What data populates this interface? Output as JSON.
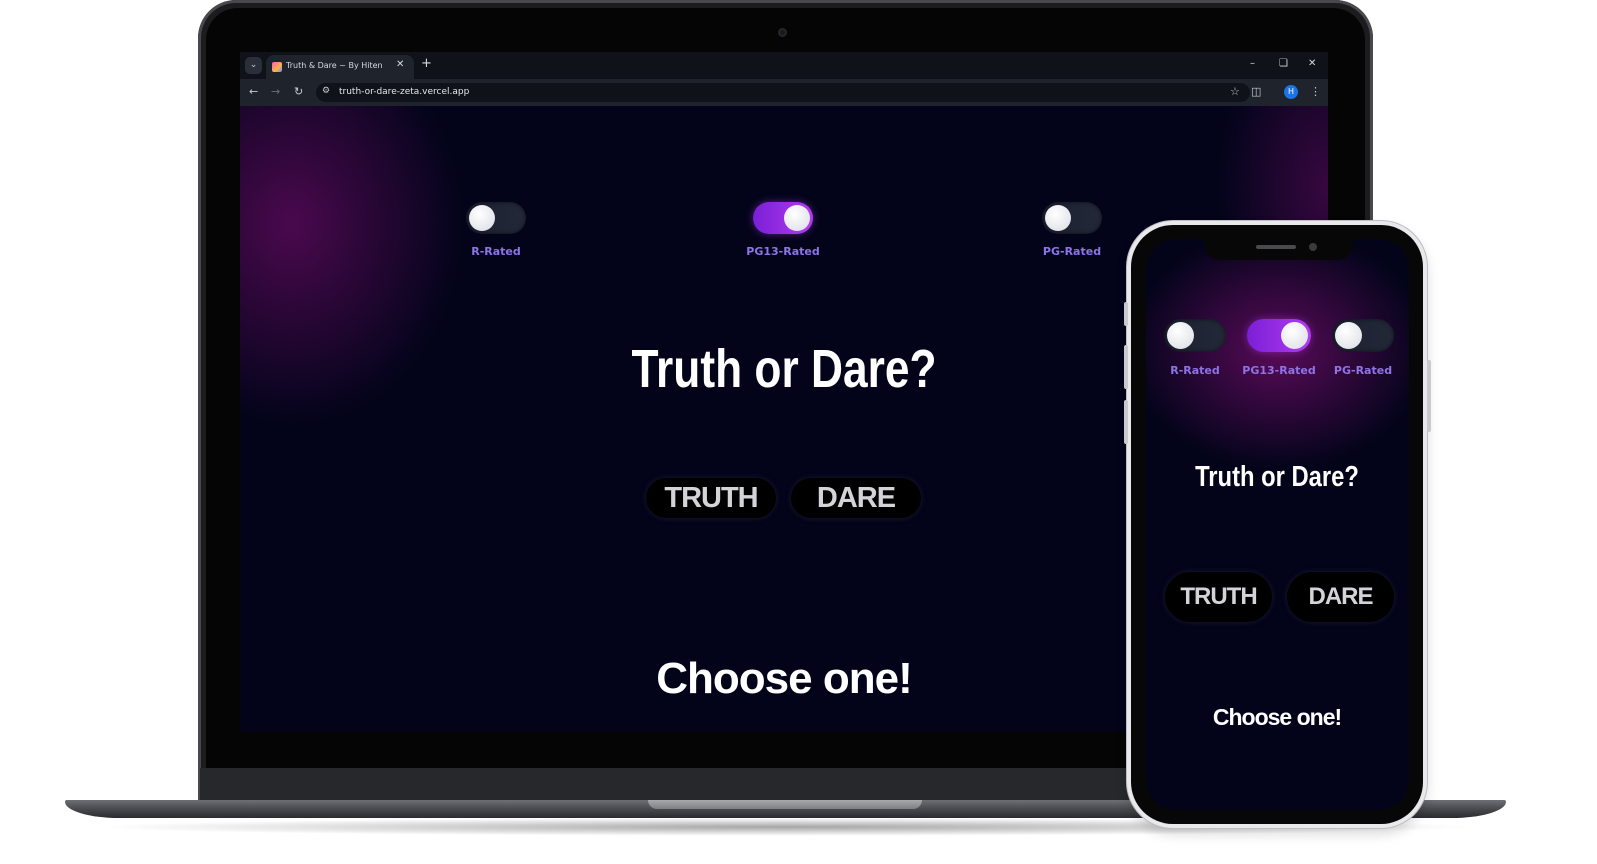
{
  "browser": {
    "tab_title": "Truth & Dare ~ By Hiten",
    "url": "truth-or-dare-zeta.vercel.app",
    "profile_initial": "H",
    "icons": [
      "tab-dropdown-icon",
      "favicon",
      "close-icon",
      "new-tab-icon",
      "minimize-icon",
      "restore-icon",
      "window-close-icon",
      "back-icon",
      "forward-icon",
      "reload-icon",
      "site-info-icon",
      "star-icon",
      "extensions-icon",
      "profile-avatar",
      "menu-icon"
    ]
  },
  "app": {
    "toggles": [
      {
        "label": "R-Rated",
        "on": false
      },
      {
        "label": "PG13-Rated",
        "on": true
      },
      {
        "label": "PG-Rated",
        "on": false
      }
    ],
    "title": "Truth or Dare?",
    "truth_label": "TRUTH",
    "dare_label": "DARE",
    "prompt": "Choose one!"
  },
  "colors": {
    "background": "#03041a",
    "accent": "#9b30e8",
    "label": "#8e74e6",
    "button_bg": "#000000"
  }
}
